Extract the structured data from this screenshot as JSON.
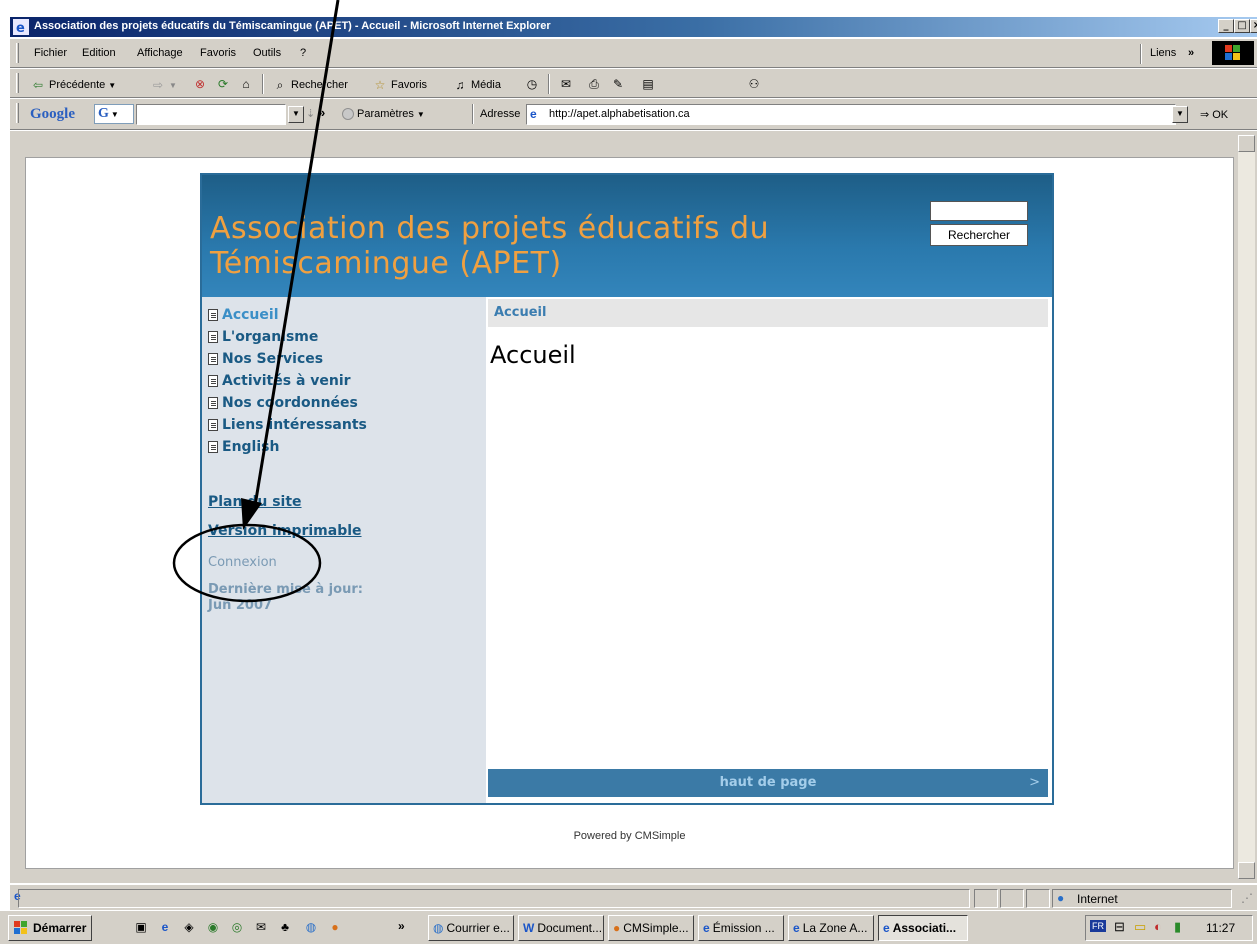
{
  "window": {
    "title": "Association des projets éducatifs du Témiscamingue (APET) - Accueil - Microsoft Internet Explorer",
    "min": "_",
    "max": "□",
    "close": "×"
  },
  "menu": {
    "items": [
      "Fichier",
      "Edition",
      "Affichage",
      "Favoris",
      "Outils",
      "?"
    ],
    "links": "Liens",
    "chevron": "»"
  },
  "toolbar": {
    "back": "Précédente",
    "search": "Rechercher",
    "favorites": "Favoris",
    "media": "Média"
  },
  "googlebar": {
    "logo": "Google",
    "g_button": "G",
    "chevron": "»",
    "settings": "Paramètres",
    "address_label": "Adresse",
    "address_value": "http://apet.alphabetisation.ca",
    "go": "OK"
  },
  "page": {
    "site_title": "Association des projets éducatifs du Témiscamingue (APET)",
    "search_button": "Rechercher",
    "search_value": "",
    "nav": [
      "Accueil",
      "L'organisme",
      "Nos Services",
      "Activités à venir",
      "Nos coordonnées",
      "Liens intéressants",
      "English"
    ],
    "sitemap": "Plan du site",
    "print_version": "Version imprimable",
    "login": "Connexion",
    "last_update_label": "Dernière mise à jour:",
    "last_update_date": "Jun 2007",
    "breadcrumb": "Accueil",
    "heading": "Accueil",
    "top_link": "haut de page",
    "top_arrow": ">",
    "powered_by": "Powered by CMSimple"
  },
  "status": {
    "zone": "Internet"
  },
  "taskbar": {
    "start": "Démarrer",
    "chevron": "»",
    "buttons": [
      "Courrier e...",
      "Document...",
      "CMSimple...",
      "Émission ...",
      "La Zone A...",
      "Associati..."
    ],
    "active_index": 5,
    "lang": "FR",
    "clock": "11:27"
  },
  "colors": {
    "header_blue": "#2a79ad",
    "title_orange": "#f0a040",
    "nav_blue": "#1a5a84",
    "annotation": "#000000"
  }
}
